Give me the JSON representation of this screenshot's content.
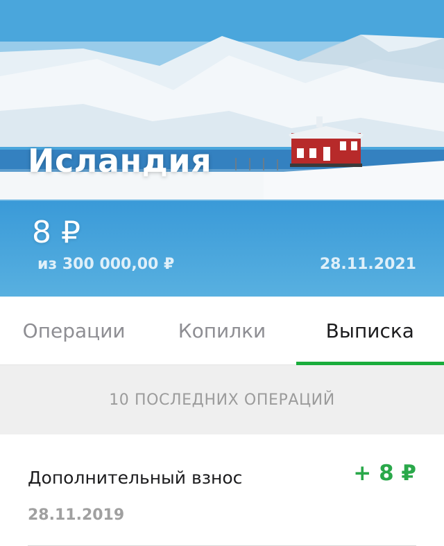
{
  "goal": {
    "name": "Исландия",
    "balance": "8 ₽",
    "target": "из 300 000,00 ₽",
    "date": "28.11.2021",
    "cover_image": "snowy-mountains-red-house"
  },
  "tabs": [
    {
      "label": "Операции",
      "active": false
    },
    {
      "label": "Копилки",
      "active": false
    },
    {
      "label": "Выписка",
      "active": true
    }
  ],
  "section_header": "10 ПОСЛЕДНИХ ОПЕРАЦИЙ",
  "operations": [
    {
      "title": "Дополнительный взнос",
      "date": "28.11.2019",
      "amount": "+ 8 ₽"
    }
  ],
  "colors": {
    "accent": "#1aad3c",
    "amount_positive": "#2aa84a",
    "section_bg": "#efefef"
  }
}
